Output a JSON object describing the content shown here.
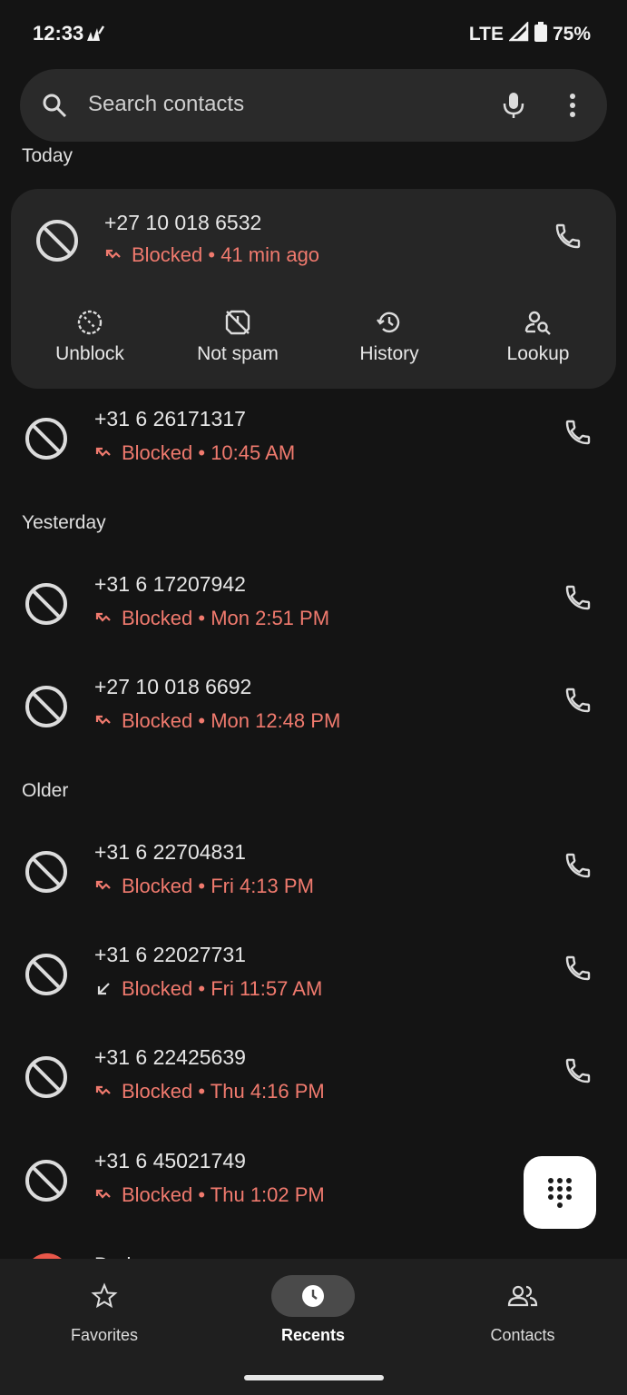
{
  "status_bar": {
    "time": "12:33",
    "network": "LTE",
    "battery": "75%"
  },
  "search": {
    "placeholder": "Search contacts"
  },
  "sections": {
    "today": "Today",
    "yesterday": "Yesterday",
    "older": "Older"
  },
  "expanded_call": {
    "number": "+27 10 018 6532",
    "status": "Blocked • 41 min ago",
    "actions": {
      "unblock": "Unblock",
      "not_spam": "Not spam",
      "history": "History",
      "lookup": "Lookup"
    }
  },
  "calls": [
    {
      "number": "+31 6 26171317",
      "status": "Blocked • 10:45 AM",
      "direction": "missed"
    },
    {
      "number": "+31 6 17207942",
      "status": "Blocked • Mon 2:51 PM",
      "direction": "missed"
    },
    {
      "number": "+27 10 018 6692",
      "status": "Blocked • Mon 12:48 PM",
      "direction": "missed"
    },
    {
      "number": "+31 6 22704831",
      "status": "Blocked • Fri 4:13 PM",
      "direction": "missed"
    },
    {
      "number": "+31 6 22027731",
      "status": "Blocked • Fri 11:57 AM",
      "direction": "incoming"
    },
    {
      "number": "+31 6 22425639",
      "status": "Blocked • Thu 4:16 PM",
      "direction": "missed"
    },
    {
      "number": "+31 6 45021749",
      "status": "Blocked • Thu 1:02 PM",
      "direction": "missed"
    }
  ],
  "partial_row": {
    "text": "Dad"
  },
  "bottom_nav": {
    "favorites": "Favorites",
    "recents": "Recents",
    "contacts": "Contacts"
  },
  "colors": {
    "background": "#141414",
    "blocked_text": "#f07a6e",
    "card": "#262626"
  }
}
